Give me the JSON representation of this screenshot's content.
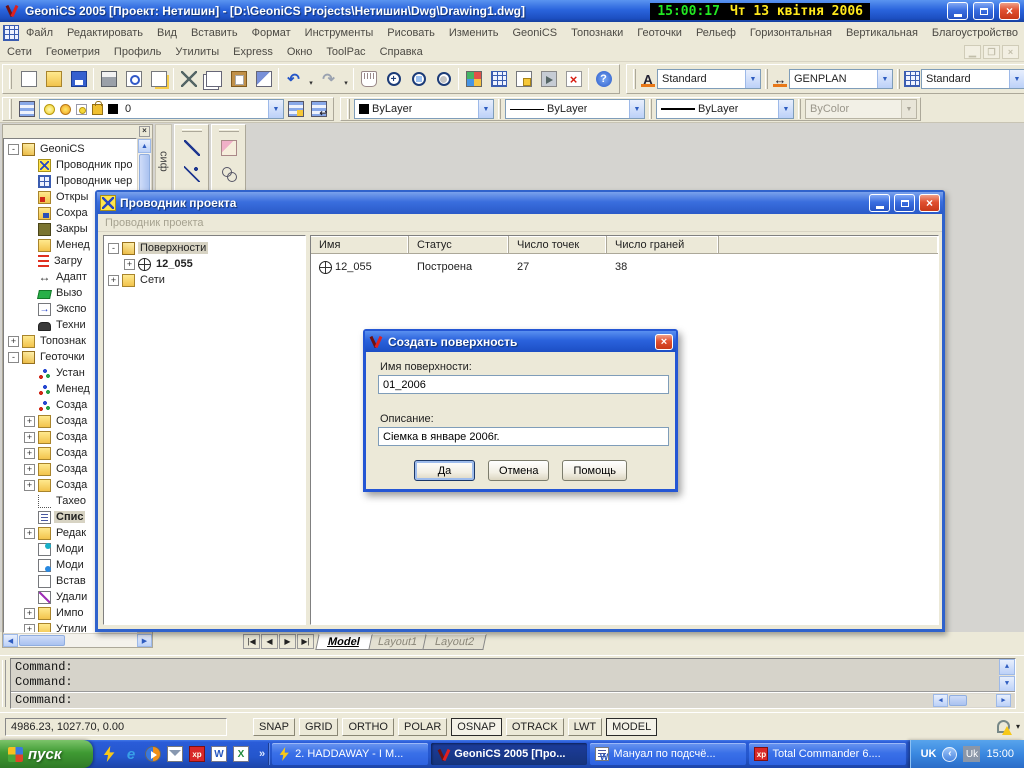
{
  "titlebar": {
    "title": "GeoniCS 2005 [Проект: Нетишин] - [D:\\GeoniCS Projects\\Нетишин\\Dwg\\Drawing1.dwg]",
    "clock_time": "15:00:17",
    "clock_date": "Чт 13 квітня 2006"
  },
  "menus": {
    "row1": [
      "Файл",
      "Редактировать",
      "Вид",
      "Вставить",
      "Формат",
      "Инструменты",
      "Рисовать",
      "Изменить",
      "GeoniCS",
      "Топознаки",
      "Геоточки",
      "Рельеф",
      "Горизонтальная",
      "Вертикальная",
      "Благоустройство"
    ],
    "row2": [
      "Сети",
      "Геометрия",
      "Профиль",
      "Утилиты",
      "Express",
      "Окно",
      "ToolPac",
      "Справка"
    ]
  },
  "toolbars": {
    "standard_icons": [
      "new-file-icon",
      "open-icon",
      "save-icon",
      "|",
      "plot-icon",
      "plot-preview-icon",
      "publish-icon",
      "|",
      "cut-icon",
      "copy-icon",
      "paste-icon",
      "match-properties-icon",
      "|",
      "undo-icon",
      "dd",
      "redo-icon",
      "dd",
      "|",
      "pan-icon",
      "zoom-realtime-icon",
      "zoom-window-icon",
      "zoom-previous-icon",
      "|",
      "sheet-set-icon",
      "table-icon",
      "block-editor-icon",
      "send-icon",
      "delete-xref-icon",
      "|",
      "help-icon"
    ],
    "styles": {
      "text_style_label": "Standard",
      "dim_style_label": "GENPLAN",
      "table_style_label": "Standard"
    },
    "layers": {
      "current_layer": "0",
      "color": "ByLayer",
      "linetype": "ByLayer",
      "lineweight": "ByLayer",
      "plot_style": "ByColor"
    }
  },
  "vertical_toolbars": {
    "label": "сиф",
    "draw_icons": [
      "line-icon",
      "construction-line-icon",
      "polyline-icon"
    ],
    "modify_icons": [
      "erase-icon",
      "copy-object-icon",
      "mirror-icon"
    ]
  },
  "palette": {
    "items": [
      {
        "label": "GeoniCS",
        "level": 0,
        "expand": "minus",
        "icon": "open-folder-icon"
      },
      {
        "label": "Проводник про",
        "level": 1,
        "icon": "wand-icon"
      },
      {
        "label": "Проводник чер",
        "level": 1,
        "icon": "drawing-explorer-icon"
      },
      {
        "label": "Откры",
        "level": 1,
        "icon": "open-drawing-icon"
      },
      {
        "label": "Сохра",
        "level": 1,
        "icon": "save-drawing-icon"
      },
      {
        "label": "Закры",
        "level": 1,
        "icon": "close-drawing-icon"
      },
      {
        "label": "Менед",
        "level": 1,
        "icon": "manager-folder-icon"
      },
      {
        "label": "Загру",
        "level": 1,
        "icon": "load-classifier-icon"
      },
      {
        "label": "Адапт",
        "level": 1,
        "icon": "adapt-icon"
      },
      {
        "label": "Вызо",
        "level": 1,
        "icon": "call-icon"
      },
      {
        "label": "Экспо",
        "level": 1,
        "icon": "export-icon"
      },
      {
        "label": "Техни",
        "level": 1,
        "icon": "support-icon"
      },
      {
        "label": "Топознак",
        "level": 0,
        "expand": "plus",
        "icon": "folder-icon"
      },
      {
        "label": "Геоточки",
        "level": 0,
        "expand": "minus",
        "icon": "open-folder-icon"
      },
      {
        "label": "Устан",
        "level": 1,
        "icon": "geopoint-tool-icon"
      },
      {
        "label": "Менед",
        "level": 1,
        "icon": "geopoint-manager-icon"
      },
      {
        "label": "Созда",
        "level": 1,
        "icon": "geopoint-create-icon"
      },
      {
        "label": "Созда",
        "level": 1,
        "expand": "plus",
        "icon": "folder-icon"
      },
      {
        "label": "Созда",
        "level": 1,
        "expand": "plus",
        "icon": "folder-icon"
      },
      {
        "label": "Созда",
        "level": 1,
        "expand": "plus",
        "icon": "folder-icon"
      },
      {
        "label": "Созда",
        "level": 1,
        "expand": "plus",
        "icon": "folder-icon"
      },
      {
        "label": "Созда",
        "level": 1,
        "expand": "plus",
        "icon": "folder-icon"
      },
      {
        "label": "Тахео",
        "level": 1,
        "icon": "tacheometry-icon"
      },
      {
        "label": "Спис",
        "level": 1,
        "icon": "list-icon",
        "bold": true,
        "selected": true
      },
      {
        "label": "Редак",
        "level": 1,
        "expand": "plus",
        "icon": "folder-icon"
      },
      {
        "label": "Моди",
        "level": 1,
        "icon": "modify-icon"
      },
      {
        "label": "Моди",
        "level": 1,
        "icon": "modify2-icon"
      },
      {
        "label": "Встав",
        "level": 1,
        "icon": "insert-icon"
      },
      {
        "label": "Удали",
        "level": 1,
        "icon": "delete-icon"
      },
      {
        "label": "Импо",
        "level": 1,
        "expand": "plus",
        "icon": "folder-icon"
      },
      {
        "label": "Утили",
        "level": 1,
        "expand": "plus",
        "icon": "folder-icon"
      }
    ]
  },
  "project_explorer": {
    "title": "Проводник проекта",
    "menu_label": "Проводник проекта",
    "tree": [
      {
        "label": "Поверхности",
        "level": 0,
        "expand": "minus",
        "icon": "open-folder-icon",
        "selected": true
      },
      {
        "label": "12_055",
        "level": 1,
        "expand": "plus",
        "icon": "surface-icon",
        "bold": true
      },
      {
        "label": "Сети",
        "level": 0,
        "expand": "plus",
        "icon": "folder-icon"
      }
    ],
    "columns": [
      "Имя",
      "Статус",
      "Число точек",
      "Число граней"
    ],
    "rows": [
      {
        "icon": "surface-icon",
        "name": "12_055",
        "status": "Построена",
        "points": "27",
        "faces": "38"
      }
    ]
  },
  "dialog": {
    "title": "Создать поверхность",
    "name_label": "Имя поверхности:",
    "name_value": "01_2006",
    "desc_label": "Описание:",
    "desc_value": "Сіемка в январе 2006г.",
    "ok_label": "Да",
    "cancel_label": "Отмена",
    "help_label": "Помощь"
  },
  "layout_tabs": {
    "tabs": [
      {
        "label": "Model",
        "active": true
      },
      {
        "label": "Layout1",
        "active": false
      },
      {
        "label": "Layout2",
        "active": false
      }
    ]
  },
  "command": {
    "history": [
      "Command:",
      "Command:"
    ],
    "prompt": "Command:"
  },
  "statusbar": {
    "coordinates": "4986.23, 1027.70, 0.00",
    "toggles": [
      {
        "label": "SNAP",
        "pressed": false
      },
      {
        "label": "GRID",
        "pressed": false
      },
      {
        "label": "ORTHO",
        "pressed": false
      },
      {
        "label": "POLAR",
        "pressed": false
      },
      {
        "label": "OSNAP",
        "pressed": true
      },
      {
        "label": "OTRACK",
        "pressed": false
      },
      {
        "label": "LWT",
        "pressed": false
      },
      {
        "label": "MODEL",
        "pressed": true
      }
    ]
  },
  "taskbar": {
    "start_label": "пуск",
    "quick_launch": [
      "winamp-icon",
      "ie-icon",
      "media-player-icon",
      "outlook-icon",
      "totalcmd-icon",
      "word-icon",
      "excel-icon"
    ],
    "overflow_chevron": "»",
    "tasks": [
      {
        "icon": "winamp-icon",
        "label": "2. HADDAWAY - I M...",
        "active": false
      },
      {
        "icon": "geonics-logo-icon",
        "label": "GeoniCS 2005 [Про...",
        "active": true
      },
      {
        "icon": "word-doc-icon",
        "label": "Мануал по подсчё...",
        "active": false
      },
      {
        "icon": "totalcmd-icon",
        "label": "Total Commander 6....",
        "active": false
      }
    ],
    "tray": {
      "lang_indicator": "UK",
      "hide_icons_chevron": "‹",
      "lang_bar": "Uk",
      "time": "15:00"
    }
  }
}
